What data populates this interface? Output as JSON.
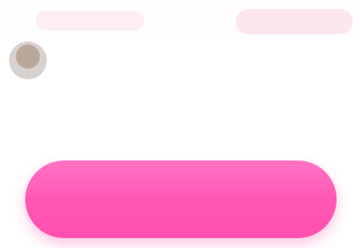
{
  "header": {
    "name": "",
    "subname": ""
  },
  "post": {
    "line1": "",
    "line2": "",
    "line3": ""
  },
  "cta": {
    "label": ""
  }
}
